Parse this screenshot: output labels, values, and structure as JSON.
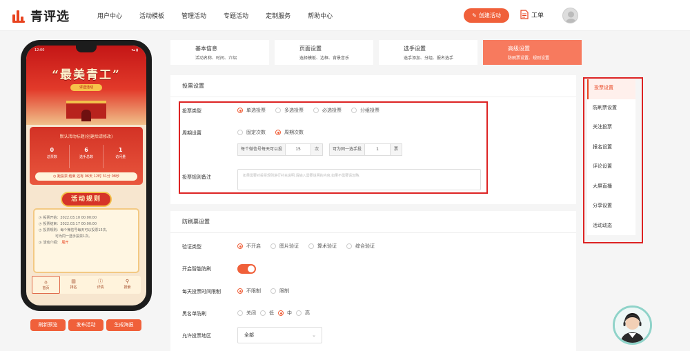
{
  "header": {
    "logo_text": "青评选",
    "nav": [
      "用户中心",
      "活动模板",
      "管理活动",
      "专题活动",
      "定制服务",
      "帮助中心"
    ],
    "create_label": "创建活动",
    "ticket_label": "工单",
    "accent": "#f0603a"
  },
  "phone": {
    "status_time": "12:00",
    "status_icons": "▾▴ ▮",
    "banner_title": "“最美青工”",
    "banner_sub": "评选活动",
    "activity_title": "默认活动标题(创建后请修改)",
    "stats": [
      {
        "value": "0",
        "label": "总票数"
      },
      {
        "value": "6",
        "label": "选手总数"
      },
      {
        "value": "1",
        "label": "访问量"
      }
    ],
    "countdown": "距投票 结束 还有 06天 12时 31分 08秒",
    "rules_title": "活动规则",
    "rules": [
      "投票开始：2022.03.10 00:00:00",
      "投票结束：2022.03.17 00:00:00",
      "投票规则：每个微信号每天可以投票15次,",
      "可为同一选手投票1次。",
      "活动介绍："
    ],
    "rules_more": "展开",
    "tabs": [
      {
        "icon": "⌂",
        "label": "首页"
      },
      {
        "icon": "▥",
        "label": "排名"
      },
      {
        "icon": "ⓘ",
        "label": "详情"
      },
      {
        "icon": "⚲",
        "label": "搜索"
      }
    ],
    "buttons": [
      "刷新预览",
      "发布活动",
      "生成海报"
    ]
  },
  "steps": [
    {
      "title": "基本信息",
      "sub": "活动名称、时间、介绍"
    },
    {
      "title": "页面设置",
      "sub": "选择模板、边框、背景音乐"
    },
    {
      "title": "选手设置",
      "sub": "选手添加、分组、报名选手"
    },
    {
      "title": "高级设置",
      "sub": "防刷票设置、规则设置"
    }
  ],
  "vote": {
    "heading": "投票设置",
    "type_label": "投票类型",
    "type_options": [
      "单选投票",
      "多选投票",
      "必选投票",
      "分组投票"
    ],
    "type_selected": 0,
    "period_label": "周期设置",
    "period_options": [
      "固定次数",
      "周期次数"
    ],
    "period_selected": 1,
    "per_day_label": "每个微信号每天可以投",
    "per_day_value": "15",
    "per_day_unit": "次",
    "same_label": "可为同一选手投",
    "same_value": "1",
    "same_unit": "票",
    "remark_label": "投票规则备注",
    "remark_placeholder": "如果需要对投票规则进行补充说明,请输入需要说明的内容,如果不需要请忽略."
  },
  "anti": {
    "heading": "防刷票设置",
    "verify_label": "验证类型",
    "verify_options": [
      "不开启",
      "图片验证",
      "算术验证",
      "综合验证"
    ],
    "verify_selected": 0,
    "smart_label": "开启智能防刷",
    "smart_on": true,
    "limit_label": "每天投票时间限制",
    "limit_options": [
      "不限制",
      "限制"
    ],
    "limit_selected": 0,
    "blacklist_label": "黑名单防刷",
    "blacklist_options": [
      "关闭",
      "低",
      "中",
      "高"
    ],
    "blacklist_selected": 2,
    "region_label": "允许投票地区",
    "region_value": "全部"
  },
  "side": [
    "投票设置",
    "防刷票设置",
    "关注投票",
    "报名设置",
    "评论设置",
    "大屏直播",
    "分享设置",
    "活动动态"
  ],
  "side_selected": 0
}
